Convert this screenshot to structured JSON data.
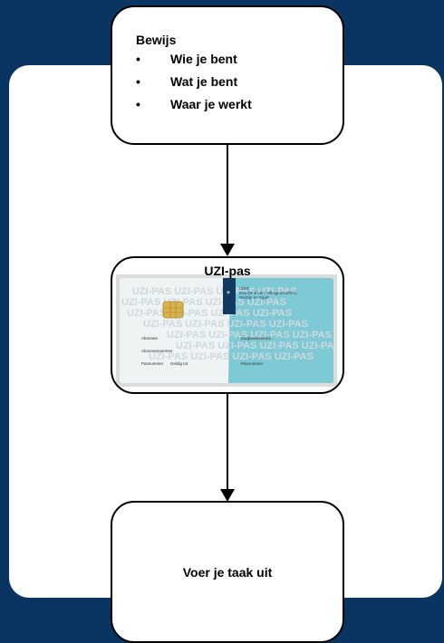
{
  "proof_box": {
    "title": "Bewijs",
    "items": [
      "Wie je bent",
      "Wat je bent",
      "Waar je werkt"
    ],
    "bullet": "•"
  },
  "card_box": {
    "title": "UZI-pas",
    "card": {
      "watermark": "UZI-PAS",
      "logo_text": "CIBG\nMinisterie van Volksgezondheid,\nWelzijn en Sport",
      "fields_left": [
        "Abonnee",
        "Abonneenummer",
        "Pasnummer",
        "Geldig tot"
      ],
      "fields_right": [
        "Zorgverlenersrol",
        "Pasnummer"
      ],
      "colors": {
        "card_left": "#eef3f4",
        "card_right": "#7ec9d6",
        "chip": "#d8b24a"
      }
    }
  },
  "task_box": {
    "label": "Voer je taak uit"
  },
  "colors": {
    "background": "#0a3563",
    "panel": "#ffffff",
    "stroke": "#000000"
  }
}
